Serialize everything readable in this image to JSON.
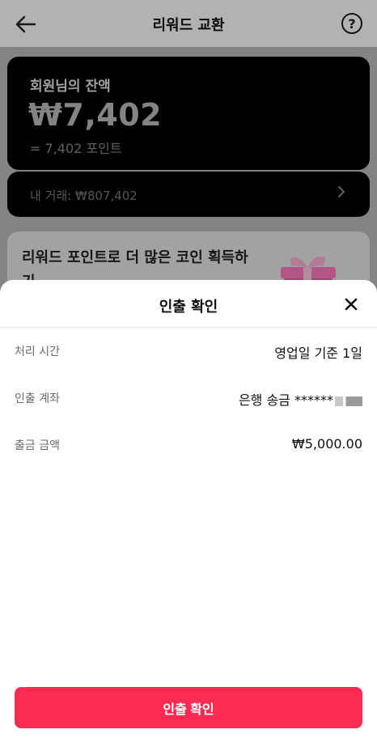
{
  "header": {
    "title": "리워드 교환"
  },
  "balance": {
    "label": "회원님의 잔액",
    "amount": "₩7,402",
    "points": "= 7,402 포인트"
  },
  "trade": {
    "label": "내 거래: ₩807,402"
  },
  "promo": {
    "text": "리워드 포인트로 더 많은 코인 획득하기"
  },
  "sheet": {
    "title": "인출 확인",
    "rows": [
      {
        "label": "처리 시간",
        "value": "영업일 기준 1일"
      },
      {
        "label": "인출 계좌",
        "value": "은행 송금 ******"
      },
      {
        "label": "출금 금액",
        "value": "₩5,000.00"
      }
    ],
    "confirm_label": "인출 확인"
  },
  "colors": {
    "accent": "#fe2c55",
    "card_bg": "#000000"
  },
  "icons": {
    "back": "arrow-left-icon",
    "help": "question-circle-icon",
    "close": "close-icon",
    "chevron": "chevron-right-icon",
    "gift": "gift-icon"
  }
}
